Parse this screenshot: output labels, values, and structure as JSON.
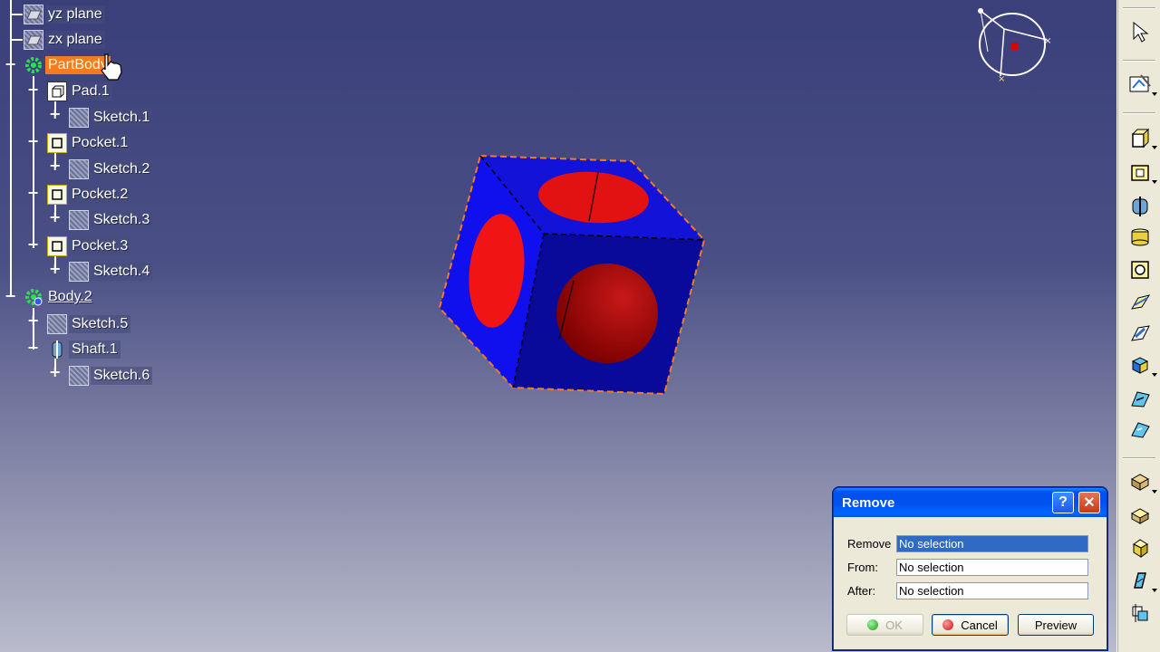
{
  "tree": {
    "nodes": [
      {
        "label": "yz plane",
        "icon": "plane-icon"
      },
      {
        "label": "zx plane",
        "icon": "plane-icon"
      },
      {
        "label": "PartBody",
        "icon": "body-gear-icon",
        "selected": true
      },
      {
        "label": "Pad.1",
        "icon": "pad-icon"
      },
      {
        "label": "Sketch.1",
        "icon": "sketch-icon"
      },
      {
        "label": "Pocket.1",
        "icon": "pocket-icon"
      },
      {
        "label": "Sketch.2",
        "icon": "sketch-icon"
      },
      {
        "label": "Pocket.2",
        "icon": "pocket-icon"
      },
      {
        "label": "Sketch.3",
        "icon": "sketch-icon"
      },
      {
        "label": "Pocket.3",
        "icon": "pocket-icon"
      },
      {
        "label": "Sketch.4",
        "icon": "sketch-icon"
      },
      {
        "label": "Body.2",
        "icon": "body-gear-icon"
      },
      {
        "label": "Sketch.5",
        "icon": "sketch-icon"
      },
      {
        "label": "Shaft.1",
        "icon": "shaft-icon"
      },
      {
        "label": "Sketch.6",
        "icon": "sketch-icon"
      }
    ]
  },
  "colors": {
    "selection": "#f47b20",
    "cube_face": "#1a1acc",
    "hole": "#e01010",
    "dialog_title": "#0053ee"
  },
  "dialog": {
    "title": "Remove",
    "fields": [
      {
        "label": "Remove",
        "value": "No selection"
      },
      {
        "label": "From:",
        "value": "No selection"
      },
      {
        "label": "After:",
        "value": "No selection"
      }
    ],
    "ok_label": "OK",
    "cancel_label": "Cancel",
    "preview_label": "Preview",
    "help_glyph": "?",
    "close_glyph": "✕"
  },
  "toolbar": {
    "icons": [
      "select-arrow-icon",
      "sketcher-icon",
      "pad-icon",
      "pocket-icon",
      "shaft-icon",
      "groove-icon",
      "hole-icon",
      "rib-icon",
      "slot-icon",
      "multi-section-solid-icon",
      "removed-multi-section-icon",
      "edge-fillet-icon",
      "chamfer-icon",
      "draft-icon",
      "shell-icon",
      "thickness-icon",
      "boolean-remove-icon"
    ]
  }
}
